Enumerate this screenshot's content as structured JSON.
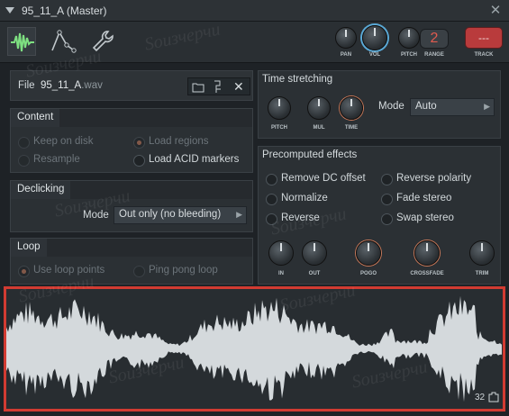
{
  "window": {
    "title": "95_11_A (Master)",
    "close": "✕"
  },
  "toolbar": {
    "pan": "PAN",
    "vol": "VOL",
    "pitch": "PITCH",
    "range": "RANGE",
    "range_value": "2",
    "track": "TRACK",
    "track_value": "---"
  },
  "file": {
    "label": "File",
    "name": "95_11_A",
    "ext": ".wav"
  },
  "content": {
    "title": "Content",
    "keep_on_disk": "Keep on disk",
    "load_regions": "Load regions",
    "resample": "Resample",
    "load_acid": "Load ACID markers"
  },
  "declicking": {
    "title": "Declicking",
    "mode_label": "Mode",
    "mode_value": "Out only (no bleeding)"
  },
  "loop": {
    "title": "Loop",
    "use_loop_points": "Use loop points",
    "ping_pong": "Ping pong loop"
  },
  "time_stretching": {
    "title": "Time stretching",
    "pitch": "PITCH",
    "mul": "MUL",
    "time": "TIME",
    "mode_label": "Mode",
    "mode_value": "Auto"
  },
  "precomputed": {
    "title": "Precomputed effects",
    "remove_dc": "Remove DC offset",
    "reverse_polarity": "Reverse polarity",
    "normalize": "Normalize",
    "fade_stereo": "Fade stereo",
    "reverse": "Reverse",
    "swap_stereo": "Swap stereo",
    "in": "IN",
    "out": "OUT",
    "pogo": "POGO",
    "crossfade": "CROSSFADE",
    "trim": "TRIM"
  },
  "waveform": {
    "zoom": "32"
  },
  "watermark": "Sоизчерчи"
}
